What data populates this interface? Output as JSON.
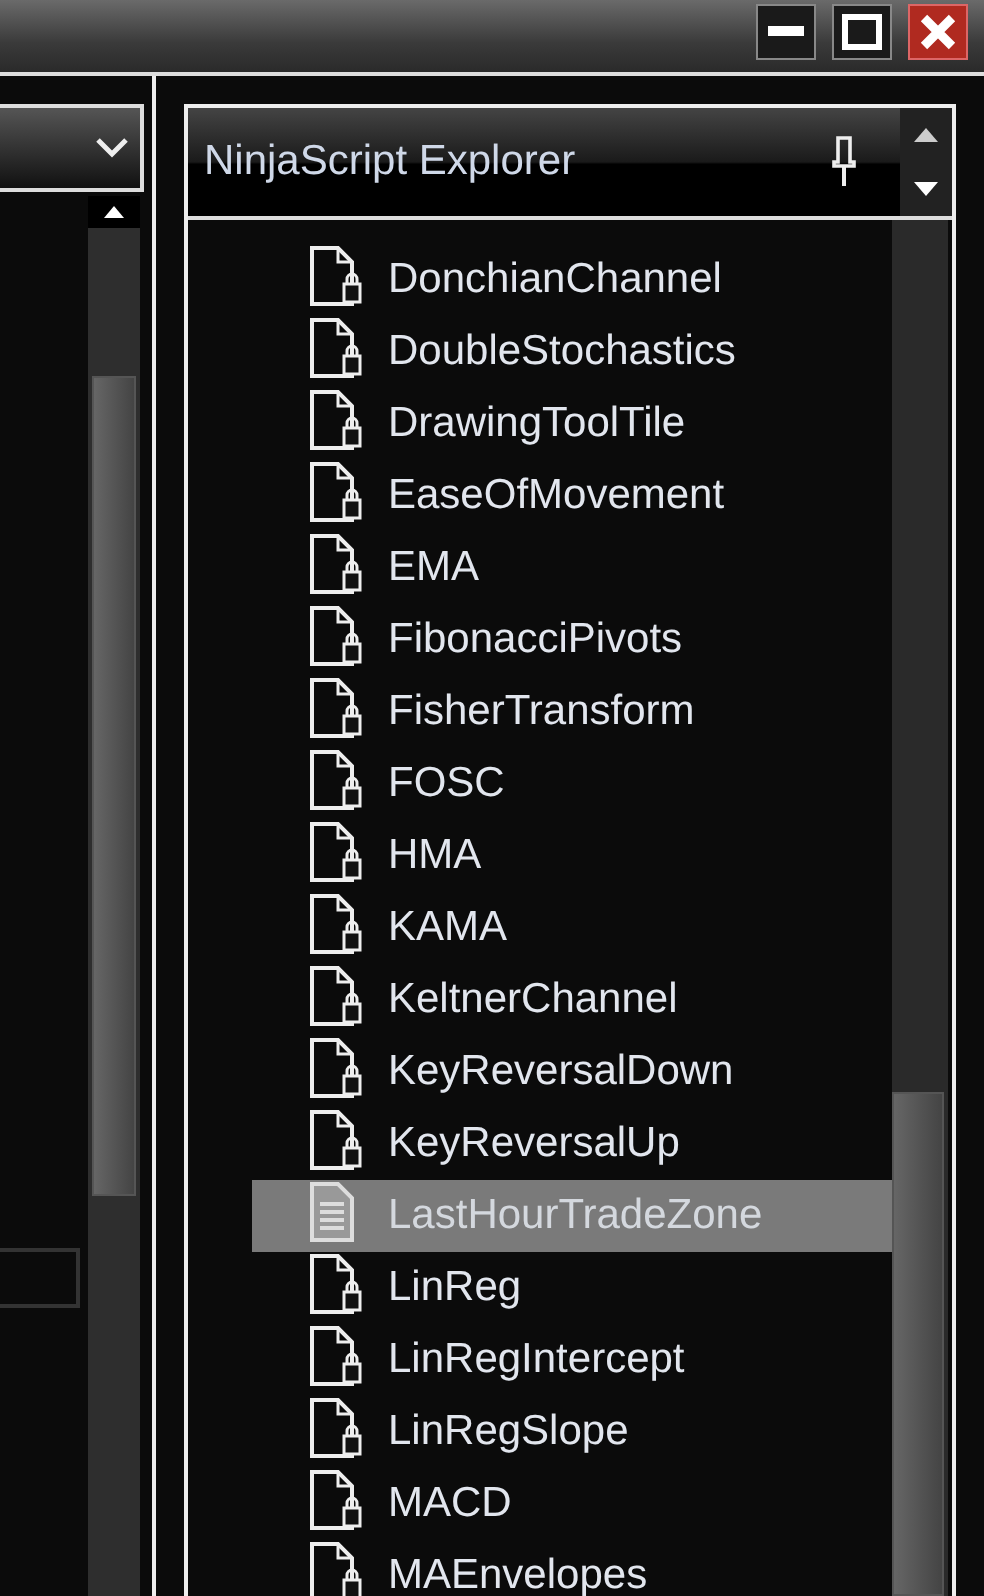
{
  "window": {
    "controls": [
      {
        "kind": "minimize"
      },
      {
        "kind": "maximize"
      },
      {
        "kind": "close"
      }
    ]
  },
  "explorer": {
    "title": "NinjaScript Explorer",
    "items": [
      {
        "label": "DonchianChannel",
        "locked": true,
        "selected": false
      },
      {
        "label": "DoubleStochastics",
        "locked": true,
        "selected": false
      },
      {
        "label": "DrawingToolTile",
        "locked": true,
        "selected": false
      },
      {
        "label": "EaseOfMovement",
        "locked": true,
        "selected": false
      },
      {
        "label": "EMA",
        "locked": true,
        "selected": false
      },
      {
        "label": "FibonacciPivots",
        "locked": true,
        "selected": false
      },
      {
        "label": "FisherTransform",
        "locked": true,
        "selected": false
      },
      {
        "label": "FOSC",
        "locked": true,
        "selected": false
      },
      {
        "label": "HMA",
        "locked": true,
        "selected": false
      },
      {
        "label": "KAMA",
        "locked": true,
        "selected": false
      },
      {
        "label": "KeltnerChannel",
        "locked": true,
        "selected": false
      },
      {
        "label": "KeyReversalDown",
        "locked": true,
        "selected": false
      },
      {
        "label": "KeyReversalUp",
        "locked": true,
        "selected": false
      },
      {
        "label": "LastHourTradeZone",
        "locked": false,
        "selected": true
      },
      {
        "label": "LinReg",
        "locked": true,
        "selected": false
      },
      {
        "label": "LinRegIntercept",
        "locked": true,
        "selected": false
      },
      {
        "label": "LinRegSlope",
        "locked": true,
        "selected": false
      },
      {
        "label": "MACD",
        "locked": true,
        "selected": false
      },
      {
        "label": "MAEnvelopes",
        "locked": true,
        "selected": false
      }
    ]
  }
}
